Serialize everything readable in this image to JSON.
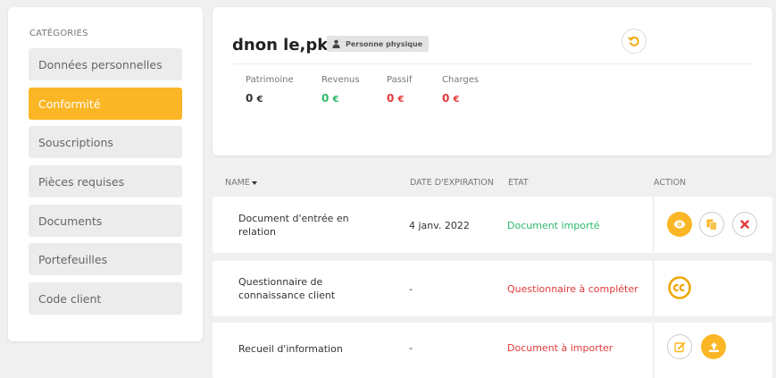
{
  "sidebar": {
    "heading": "CATÉGORIES",
    "items": [
      {
        "label": "Données personnelles",
        "active": false
      },
      {
        "label": "Conformité",
        "active": true
      },
      {
        "label": "Souscriptions",
        "active": false
      },
      {
        "label": "Pièces requises",
        "active": false
      },
      {
        "label": "Documents",
        "active": false
      },
      {
        "label": "Portefeuilles",
        "active": false
      },
      {
        "label": "Code client",
        "active": false
      }
    ]
  },
  "header": {
    "client_name": "dnon le,pk",
    "badge": "Personne physique",
    "stats": [
      {
        "label": "Patrimoine",
        "value": "0",
        "currency": "€",
        "color": "#333333"
      },
      {
        "label": "Revenus",
        "value": "0",
        "currency": "€",
        "color": "#2dba6c"
      },
      {
        "label": "Passif",
        "value": "0",
        "currency": "€",
        "color": "#e23a3a"
      },
      {
        "label": "Charges",
        "value": "0",
        "currency": "€",
        "color": "#e23a3a"
      }
    ]
  },
  "table": {
    "columns": {
      "name": "NAME",
      "expiration": "DATE D'EXPIRATION",
      "state": "ETAT",
      "action": "ACTION"
    },
    "rows": [
      {
        "name": "Document d'entrée en relation",
        "expiration": "4 janv. 2022",
        "state": "Document importé",
        "state_color": "green",
        "actions": [
          "view-icon",
          "copy-icon",
          "delete-icon"
        ]
      },
      {
        "name": "Questionnaire de connaissance client",
        "expiration": "-",
        "state": "Questionnaire à compléter",
        "state_color": "red",
        "actions": [
          "cc-icon"
        ]
      },
      {
        "name": "Recueil d'information",
        "expiration": "-",
        "state": "Document à importer",
        "state_color": "red",
        "actions": [
          "edit-icon",
          "upload-icon"
        ]
      }
    ]
  },
  "colors": {
    "accent": "#fbb626",
    "success": "#2dba6c",
    "danger": "#e23a3a"
  }
}
